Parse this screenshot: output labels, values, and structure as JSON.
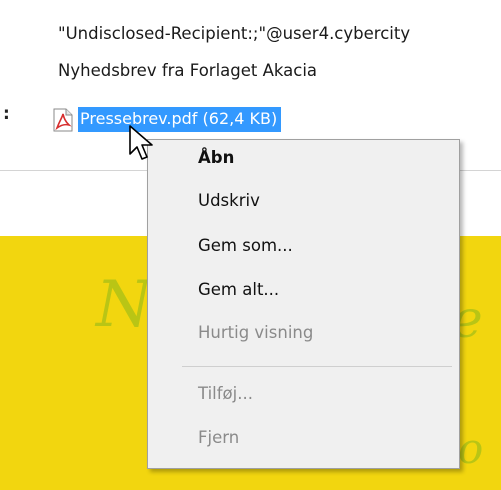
{
  "header": {
    "to": "\"Undisclosed-Recipient:;\"@user4.cybercity",
    "subject": "Nyhedsbrev fra Forlaget Akacia",
    "attachments_label": ":",
    "attachment": {
      "name": "Pressebrev.pdf (62,4 KB)",
      "icon": "pdf-file-icon"
    }
  },
  "banner": {
    "color": "#f2d60f",
    "glyphs": [
      "N",
      "e",
      "o"
    ]
  },
  "context_menu": {
    "items": [
      {
        "label": "Åbn",
        "bold": true,
        "enabled": true
      },
      {
        "label": "Udskriv",
        "enabled": true
      },
      {
        "label": "Gem som...",
        "enabled": true
      },
      {
        "label": "Gem alt...",
        "enabled": true
      },
      {
        "label": "Hurtig visning",
        "enabled": false
      },
      {
        "label": "Tilføj...",
        "enabled": false
      },
      {
        "label": "Fjern",
        "enabled": false
      }
    ]
  },
  "cursor": {
    "icon": "arrow-cursor-icon"
  }
}
